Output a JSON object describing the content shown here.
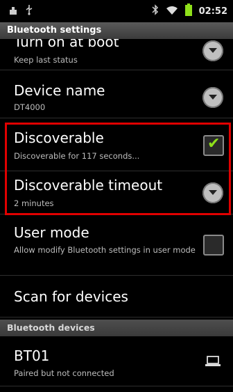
{
  "status_bar": {
    "time": "02:52",
    "icons": [
      "signal-icon",
      "usb-icon",
      "bluetooth-icon",
      "wifi-icon",
      "battery-icon"
    ]
  },
  "header": {
    "title": "Bluetooth settings"
  },
  "settings": {
    "turn_on_boot": {
      "title": "Turn on at boot",
      "summary": "Keep last status"
    },
    "device_name": {
      "title": "Device name",
      "summary": "DT4000"
    },
    "discoverable": {
      "title": "Discoverable",
      "summary": "Discoverable for 117 seconds...",
      "checked": true
    },
    "discoverable_timeout": {
      "title": "Discoverable timeout",
      "summary": "2 minutes"
    },
    "user_mode": {
      "title": "User mode",
      "summary": "Allow modify Bluetooth settings in user mode",
      "checked": false
    },
    "scan": {
      "title": "Scan for devices"
    }
  },
  "devices_section": {
    "label": "Bluetooth devices"
  },
  "devices": [
    {
      "name": "BT01",
      "status": "Paired but not connected",
      "icon": "laptop-icon"
    }
  ],
  "colors": {
    "highlight": "#e00000",
    "check": "#8fe01a",
    "background": "#000000"
  }
}
